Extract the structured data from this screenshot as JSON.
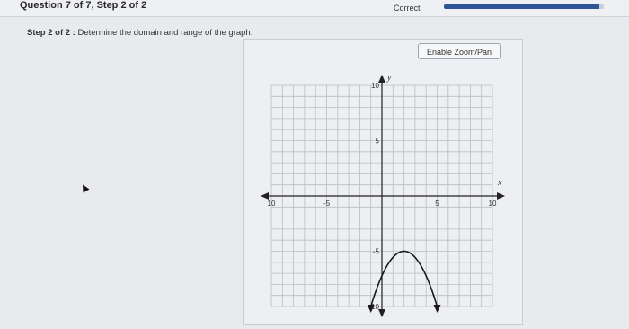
{
  "header": {
    "question_title": "Question 7 of 7, Step 2 of 2",
    "status": "Correct",
    "progress_fraction": 0.97
  },
  "prompt": {
    "step_label": "Step 2 of 2 :",
    "text": "Determine the domain and range of the graph."
  },
  "toolbar": {
    "zoom_label": "Enable Zoom/Pan"
  },
  "graph": {
    "x_axis_label": "x",
    "y_axis_label": "y",
    "x_range": [
      -10,
      10
    ],
    "y_range": [
      -10,
      10
    ],
    "x_tick_labels": [
      "10",
      "-5",
      "5",
      "10"
    ],
    "y_tick_labels": [
      "10",
      "5",
      "-5",
      "10"
    ],
    "curve": {
      "type": "parabola",
      "vertex": [
        2,
        -5
      ],
      "endpoints": [
        [
          -1,
          -10
        ],
        [
          5,
          -10
        ]
      ],
      "opens": "down",
      "color": "#1a1a1a"
    },
    "grid": true,
    "colors": {
      "grid": "#b9bdc4",
      "axis": "#222222"
    }
  }
}
